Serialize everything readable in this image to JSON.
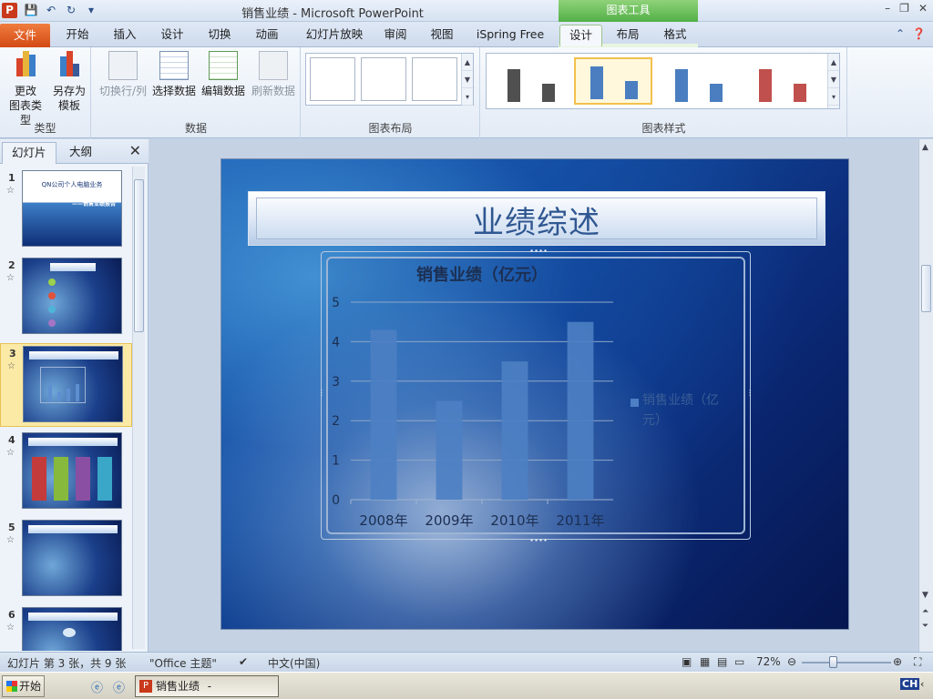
{
  "window": {
    "app_icon": "P",
    "title": "销售业绩 - Microsoft PowerPoint",
    "context_tool": "图表工具",
    "controls": [
      "–",
      "❐",
      "✕"
    ]
  },
  "tabs": [
    "文件",
    "开始",
    "插入",
    "设计",
    "切换",
    "动画",
    "幻灯片放映",
    "审阅",
    "视图",
    "iSpring Free",
    "设计",
    "布局",
    "格式"
  ],
  "ribbon": {
    "type_group": {
      "label": "类型",
      "btn1": [
        "更改",
        "图表类型"
      ],
      "btn2": [
        "另存为",
        "模板"
      ]
    },
    "data_group": {
      "label": "数据",
      "switch": "切换行/列",
      "select": "选择数据",
      "edit": "编辑数据",
      "refresh": "刷新数据"
    },
    "layout_group": {
      "label": "图表布局"
    },
    "style_group": {
      "label": "图表样式",
      "styles": [
        "#505050",
        "#4a7ec0",
        "#4a7ec0",
        "#c0504d"
      ]
    }
  },
  "left_pane": {
    "tab_slides": "幻灯片",
    "tab_outline": "大纲",
    "slides": [
      {
        "num": "1",
        "title": "QN公司个人电脑业务",
        "subtitle": "——销售业绩报告"
      },
      {
        "num": "2"
      },
      {
        "num": "3"
      },
      {
        "num": "4"
      },
      {
        "num": "5"
      },
      {
        "num": "6"
      }
    ]
  },
  "slide": {
    "title": "业绩综述"
  },
  "chart_data": {
    "type": "bar",
    "title": "销售业绩（亿元）",
    "categories": [
      "2008年",
      "2009年",
      "2010年",
      "2011年"
    ],
    "series": [
      {
        "name": "销售业绩（亿元）",
        "values": [
          4.3,
          2.5,
          3.5,
          4.5
        ],
        "color": "#4c7fc3"
      }
    ],
    "ylim": [
      0,
      5
    ],
    "yticks": [
      "0",
      "1",
      "2",
      "3",
      "4",
      "5"
    ],
    "grid": true,
    "legend": "right"
  },
  "status": {
    "slide_info": "幻灯片 第 3 张，共 9 张",
    "theme": "\"Office 主题\"",
    "language": "中文(中国)",
    "zoom": "72%"
  },
  "taskbar": {
    "start": "开始",
    "task": "销售业绩 - Microsof...",
    "ime": "CH"
  }
}
